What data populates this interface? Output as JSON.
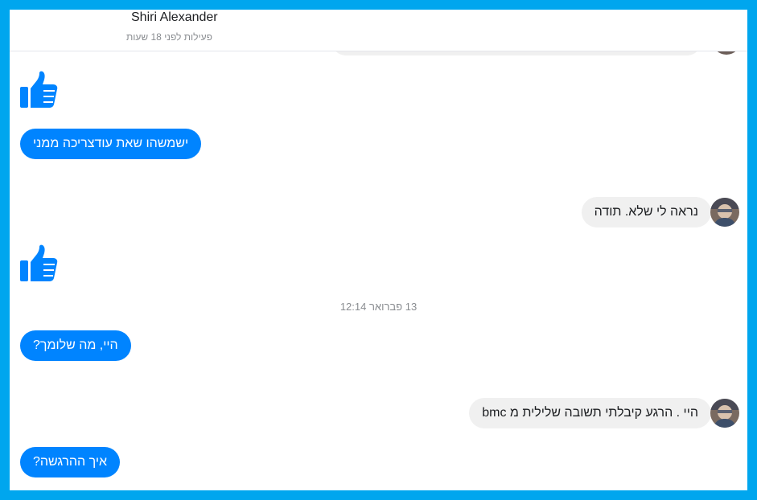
{
  "header": {
    "name": "Shiri Alexander",
    "status": "פעילות לפני 18 שעות"
  },
  "messages": {
    "m1": "ישמשהו שאת עודצריכה ממני",
    "m2": "נראה לי שלא. תודה",
    "timestamp": "13 פברואר 12:14",
    "m3": "היי, מה שלומך?",
    "m4": "היי . הרגע קיבלתי תשובה שלילית מ bmc",
    "m5": "איך ההרגשה?"
  },
  "icons": {
    "like": "thumbs-up-icon",
    "avatar": "contact-avatar"
  },
  "colors": {
    "frame": "#00a6ee",
    "outgoing": "#0084ff",
    "incoming": "#f0f0f0"
  }
}
